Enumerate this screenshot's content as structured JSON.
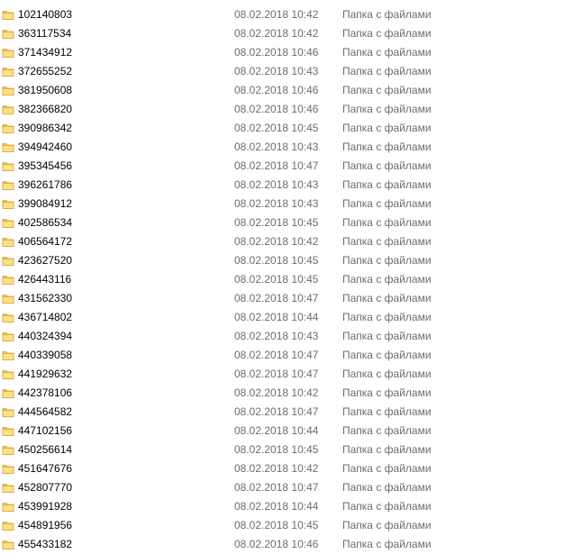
{
  "icon": "folder-icon",
  "colors": {
    "folder_body": "#FFE08A",
    "folder_tab": "#F2C14E",
    "folder_edge": "#D9A632",
    "meta_text": "#6D6D6D"
  },
  "files": [
    {
      "name": "102140803",
      "date": "08.02.2018 10:42",
      "type": "Папка с файлами"
    },
    {
      "name": "363117534",
      "date": "08.02.2018 10:42",
      "type": "Папка с файлами"
    },
    {
      "name": "371434912",
      "date": "08.02.2018 10:46",
      "type": "Папка с файлами"
    },
    {
      "name": "372655252",
      "date": "08.02.2018 10:43",
      "type": "Папка с файлами"
    },
    {
      "name": "381950608",
      "date": "08.02.2018 10:46",
      "type": "Папка с файлами"
    },
    {
      "name": "382366820",
      "date": "08.02.2018 10:46",
      "type": "Папка с файлами"
    },
    {
      "name": "390986342",
      "date": "08.02.2018 10:45",
      "type": "Папка с файлами"
    },
    {
      "name": "394942460",
      "date": "08.02.2018 10:43",
      "type": "Папка с файлами"
    },
    {
      "name": "395345456",
      "date": "08.02.2018 10:47",
      "type": "Папка с файлами"
    },
    {
      "name": "396261786",
      "date": "08.02.2018 10:43",
      "type": "Папка с файлами"
    },
    {
      "name": "399084912",
      "date": "08.02.2018 10:43",
      "type": "Папка с файлами"
    },
    {
      "name": "402586534",
      "date": "08.02.2018 10:45",
      "type": "Папка с файлами"
    },
    {
      "name": "406564172",
      "date": "08.02.2018 10:42",
      "type": "Папка с файлами"
    },
    {
      "name": "423627520",
      "date": "08.02.2018 10:45",
      "type": "Папка с файлами"
    },
    {
      "name": "426443116",
      "date": "08.02.2018 10:45",
      "type": "Папка с файлами"
    },
    {
      "name": "431562330",
      "date": "08.02.2018 10:47",
      "type": "Папка с файлами"
    },
    {
      "name": "436714802",
      "date": "08.02.2018 10:44",
      "type": "Папка с файлами"
    },
    {
      "name": "440324394",
      "date": "08.02.2018 10:43",
      "type": "Папка с файлами"
    },
    {
      "name": "440339058",
      "date": "08.02.2018 10:47",
      "type": "Папка с файлами"
    },
    {
      "name": "441929632",
      "date": "08.02.2018 10:47",
      "type": "Папка с файлами"
    },
    {
      "name": "442378106",
      "date": "08.02.2018 10:42",
      "type": "Папка с файлами"
    },
    {
      "name": "444564582",
      "date": "08.02.2018 10:47",
      "type": "Папка с файлами"
    },
    {
      "name": "447102156",
      "date": "08.02.2018 10:44",
      "type": "Папка с файлами"
    },
    {
      "name": "450256614",
      "date": "08.02.2018 10:45",
      "type": "Папка с файлами"
    },
    {
      "name": "451647676",
      "date": "08.02.2018 10:42",
      "type": "Папка с файлами"
    },
    {
      "name": "452807770",
      "date": "08.02.2018 10:47",
      "type": "Папка с файлами"
    },
    {
      "name": "453991928",
      "date": "08.02.2018 10:44",
      "type": "Папка с файлами"
    },
    {
      "name": "454891956",
      "date": "08.02.2018 10:45",
      "type": "Папка с файлами"
    },
    {
      "name": "455433182",
      "date": "08.02.2018 10:46",
      "type": "Папка с файлами"
    }
  ]
}
